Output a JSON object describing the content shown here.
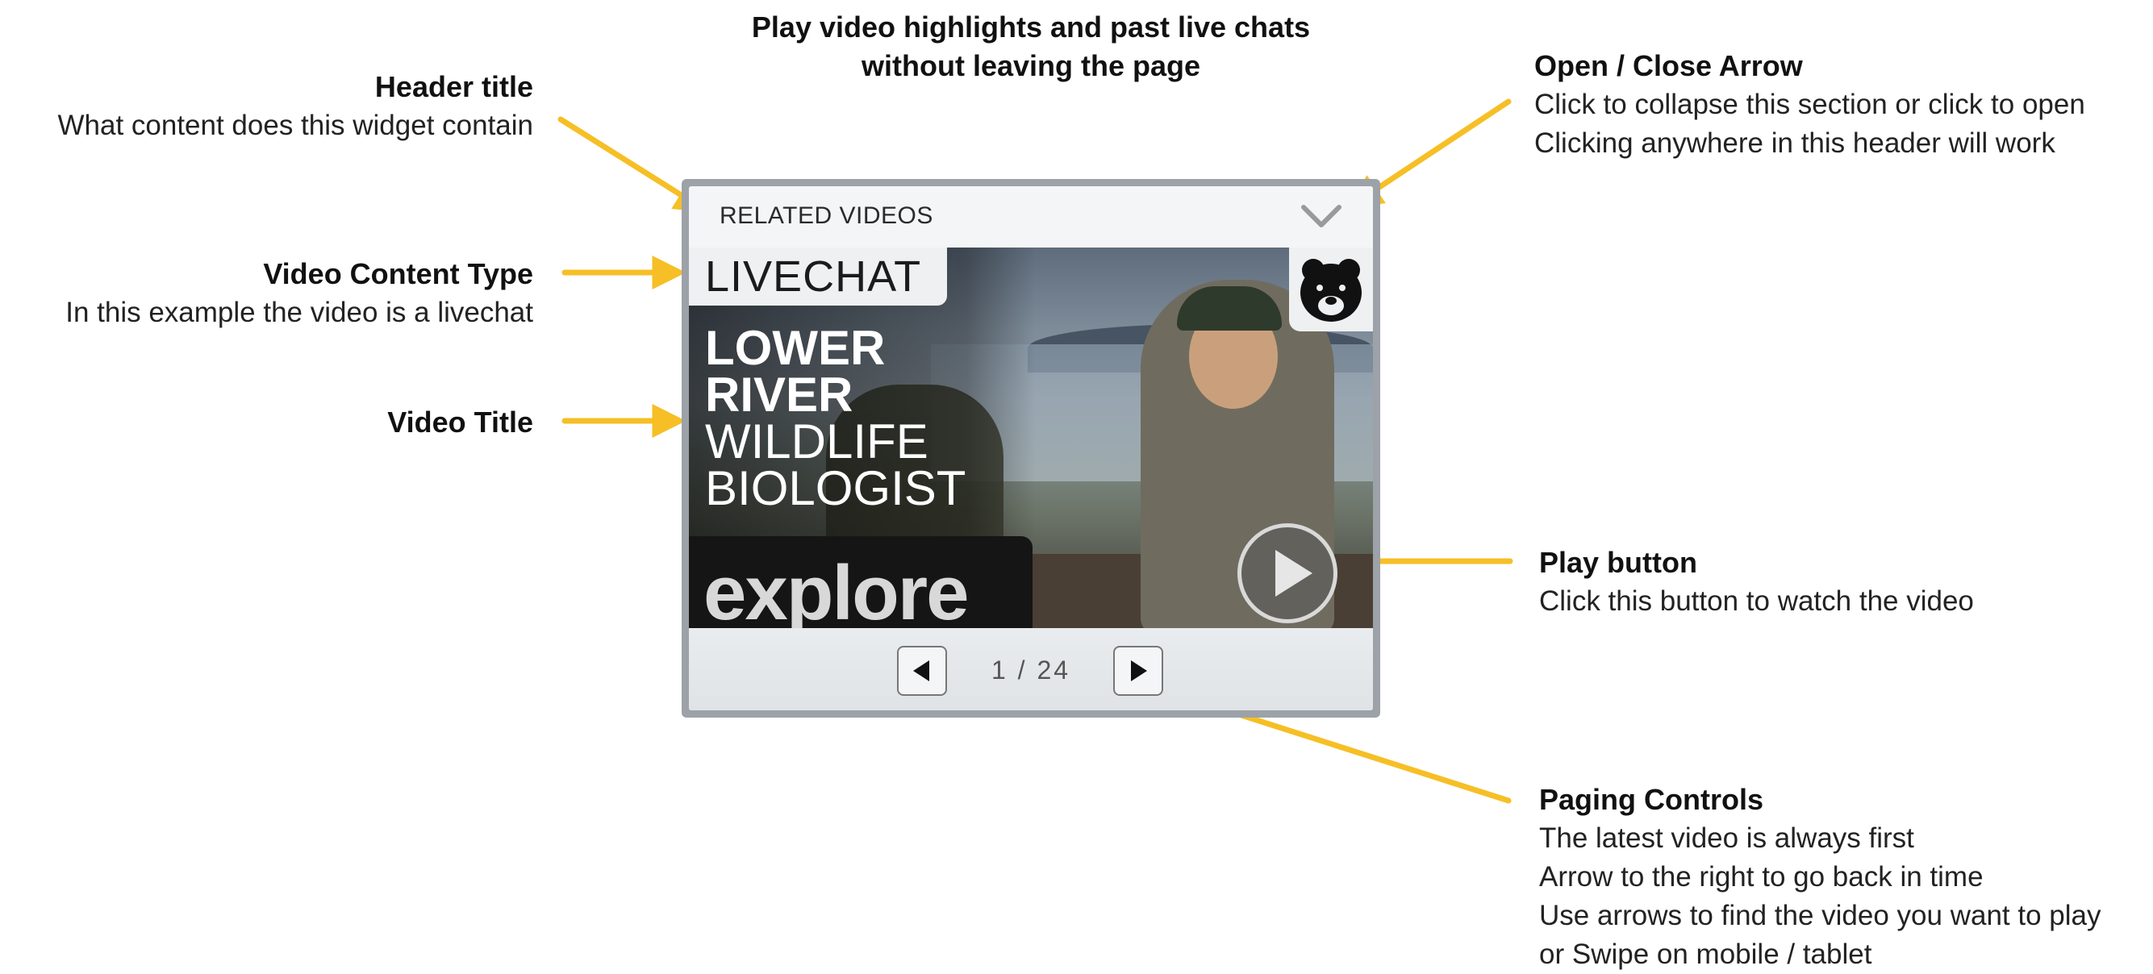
{
  "annotations": {
    "intro": {
      "line1": "Play video highlights and past live chats",
      "line2": "without leaving the page"
    },
    "header_title": {
      "title": "Header title",
      "desc": "What content does this widget contain"
    },
    "content_type": {
      "title": "Video Content Type",
      "desc": "In this example the video is a livechat"
    },
    "video_title": {
      "title": "Video Title"
    },
    "open_close": {
      "title": "Open / Close Arrow",
      "desc1": "Click to collapse this section or click to open",
      "desc2": "Clicking anywhere in this header will work"
    },
    "play": {
      "title": "Play button",
      "desc": "Click this button to watch the video"
    },
    "paging": {
      "title": "Paging Controls",
      "desc1": "The latest video is always first",
      "desc2": "Arrow to the right to go back in time",
      "desc3": "Use arrows to find the video you want to play",
      "desc4": "or Swipe on mobile / tablet"
    }
  },
  "widget": {
    "header_label": "RELATED VIDEOS",
    "content_type": "LIVECHAT",
    "video_title": {
      "line1": "LOWER",
      "line2": "RIVER",
      "line3": "WILDLIFE",
      "line4": "BIOLOGIST"
    },
    "brand": "explore",
    "pager": {
      "current": "1",
      "separator": "/",
      "total": "24"
    }
  },
  "icons": {
    "collapse": "chevron-down-icon",
    "play": "play-icon",
    "prev": "prev-arrow-icon",
    "next": "next-arrow-icon",
    "brand": "bear-logo-icon"
  },
  "colors": {
    "annotation_arrow": "#f6bf26",
    "widget_border": "#9ca2a8"
  }
}
